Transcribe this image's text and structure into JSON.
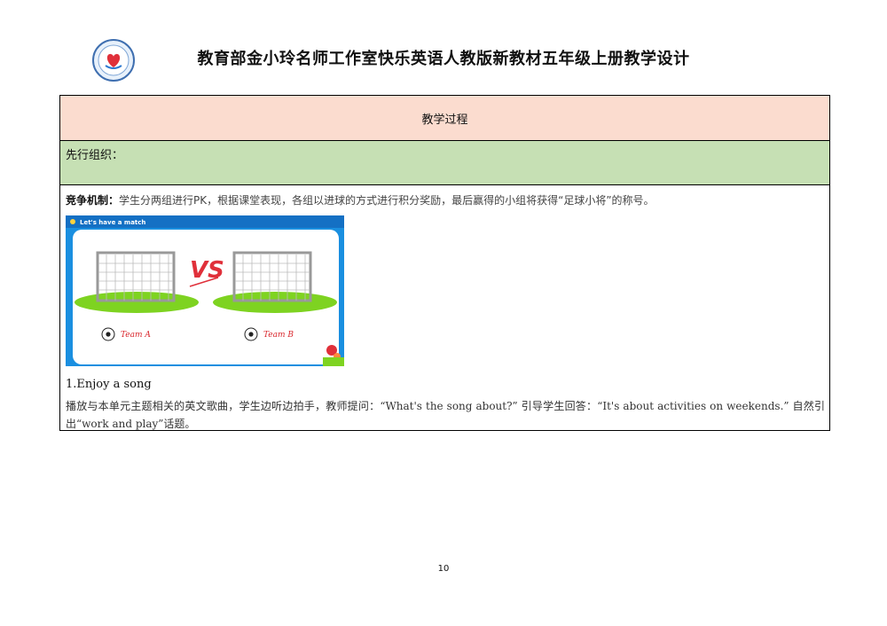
{
  "header": {
    "title": "教育部金小玲名师工作室快乐英语人教版新教材五年级上册教学设计",
    "logo_icon": "studio-seal-icon"
  },
  "table": {
    "head": "教学过程",
    "organizer_label": "先行组织：",
    "rule_label": "竞争机制：",
    "rule_text": "学生分两组进行PK，根据课堂表现，各组以进球的方式进行积分奖励，最后赢得的小组将获得“足球小将”的称号。",
    "slide": {
      "title": "Let's have a match",
      "versus": "VS",
      "team_a": "Team A",
      "team_b": "Team B"
    },
    "section_title": "1.Enjoy a song",
    "paragraph": "播放与本单元主题相关的英文歌曲，学生边听边拍手，教师提问：“What's the song about?” 引导学生回答：“It's about activities on weekends.” 自然引出“work and play”话题。"
  },
  "page_number": "10",
  "colors": {
    "head_bg": "#fbdccf",
    "green_bg": "#c6e0b4",
    "slide_blue": "#1a8fe0",
    "grass": "#7ed321"
  }
}
